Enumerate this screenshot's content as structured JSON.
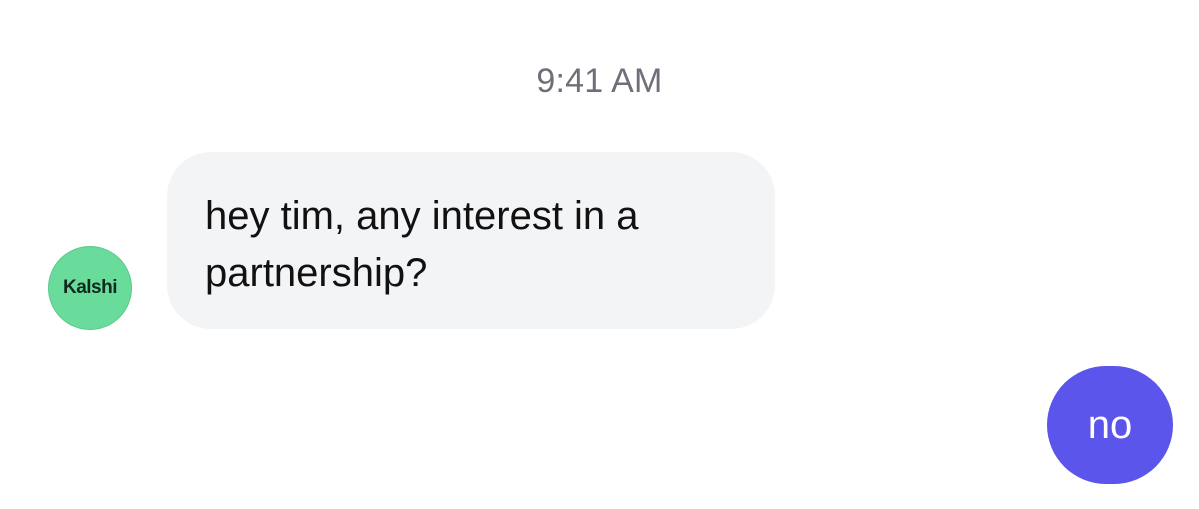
{
  "conversation": {
    "timestamp": "9:41 AM",
    "sender_avatar": {
      "label": "Kalshi",
      "color": "#69dc9c"
    },
    "messages": [
      {
        "direction": "incoming",
        "text": "hey tim, any interest in a partnership?",
        "color": "#f3f4f6"
      },
      {
        "direction": "outgoing",
        "text": "no",
        "color": "#5b55ec"
      }
    ]
  }
}
